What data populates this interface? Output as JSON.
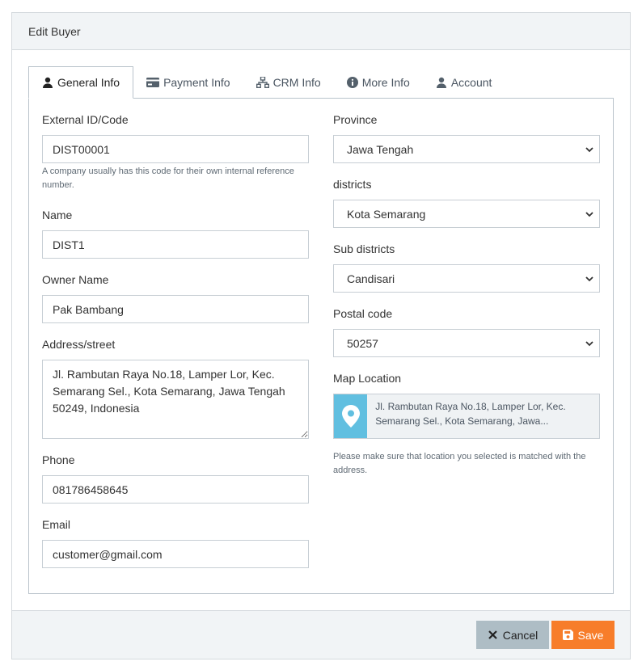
{
  "modal": {
    "title": "Edit Buyer"
  },
  "tabs": [
    {
      "label": "General Info",
      "icon": "user-icon",
      "active": true
    },
    {
      "label": "Payment Info",
      "icon": "credit-card-icon",
      "active": false
    },
    {
      "label": "CRM Info",
      "icon": "sitemap-icon",
      "active": false
    },
    {
      "label": "More Info",
      "icon": "info-circle-icon",
      "active": false
    },
    {
      "label": "Account",
      "icon": "user-icon",
      "active": false
    }
  ],
  "form": {
    "external_id": {
      "label": "External ID/Code",
      "value": "DIST00001",
      "help": "A company usually has this code for their own internal reference number."
    },
    "name": {
      "label": "Name",
      "value": "DIST1"
    },
    "owner_name": {
      "label": "Owner Name",
      "value": "Pak Bambang"
    },
    "address": {
      "label": "Address/street",
      "value": "Jl. Rambutan Raya No.18, Lamper Lor, Kec. Semarang Sel., Kota Semarang, Jawa Tengah 50249, Indonesia"
    },
    "phone": {
      "label": "Phone",
      "value": "081786458645"
    },
    "email": {
      "label": "Email",
      "value": "customer@gmail.com"
    },
    "province": {
      "label": "Province",
      "value": "Jawa Tengah"
    },
    "districts": {
      "label": "districts",
      "value": "Kota Semarang"
    },
    "sub_districts": {
      "label": "Sub districts",
      "value": "Candisari"
    },
    "postal_code": {
      "label": "Postal code",
      "value": "50257"
    },
    "map_location": {
      "label": "Map Location",
      "value": "Jl. Rambutan Raya No.18, Lamper Lor, Kec. Semarang Sel., Kota Semarang, Jawa...",
      "help": "Please make sure that location you selected is matched with the address."
    }
  },
  "footer": {
    "cancel_label": "Cancel",
    "save_label": "Save"
  },
  "colors": {
    "accent": "#f77d2a",
    "cancel": "#aebdc5",
    "map_pin_bg": "#61bfe0"
  }
}
